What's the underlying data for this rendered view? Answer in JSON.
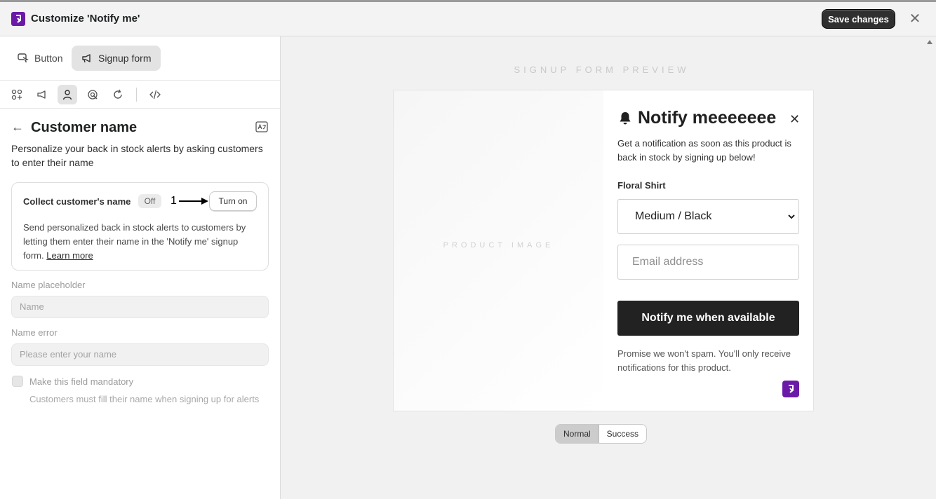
{
  "window": {
    "title": "Customize 'Notify me'",
    "save_label": "Save changes",
    "close_icon": "close-icon"
  },
  "sidebar": {
    "modes": [
      {
        "label": "Button",
        "icon": "cursor-click-icon",
        "active": false
      },
      {
        "label": "Signup form",
        "icon": "megaphone-icon",
        "active": true
      }
    ],
    "icon_tabs": [
      "apps-icon",
      "megaphone-icon",
      "person-icon",
      "target-icon",
      "refresh-icon",
      "code-icon"
    ],
    "active_icon_tab": "person-icon",
    "section": {
      "title": "Customer name",
      "description": "Personalize your back in stock alerts by asking customers to enter their name"
    },
    "collect_card": {
      "label": "Collect customer's name",
      "status": "Off",
      "annotation": "1",
      "button_label": "Turn on",
      "description": "Send personalized back in stock alerts to customers by letting them enter their name in the 'Notify me' signup form.",
      "learn_more": "Learn more"
    },
    "name_placeholder": {
      "label": "Name placeholder",
      "value": "Name"
    },
    "name_error": {
      "label": "Name error",
      "value": "Please enter your name"
    },
    "mandatory": {
      "label": "Make this field mandatory",
      "help": "Customers must fill their name when signing up for alerts",
      "checked": false
    }
  },
  "preview": {
    "label": "SIGNUP FORM PREVIEW",
    "product_image_label": "PRODUCT IMAGE",
    "form": {
      "title": "Notify meeeeeee",
      "description": "Get a notification as soon as this product is back in stock by signing up below!",
      "product_name": "Floral Shirt",
      "variant": "Medium / Black",
      "email_placeholder": "Email address",
      "submit_label": "Notify me when available",
      "spam_note": "Promise we won't spam. You'll only receive notifications for this product."
    },
    "states": [
      {
        "label": "Normal",
        "active": true
      },
      {
        "label": "Success",
        "active": false
      }
    ]
  },
  "colors": {
    "brand": "#6b1aa8",
    "primary_button": "#303030",
    "submit_button": "#222222"
  }
}
